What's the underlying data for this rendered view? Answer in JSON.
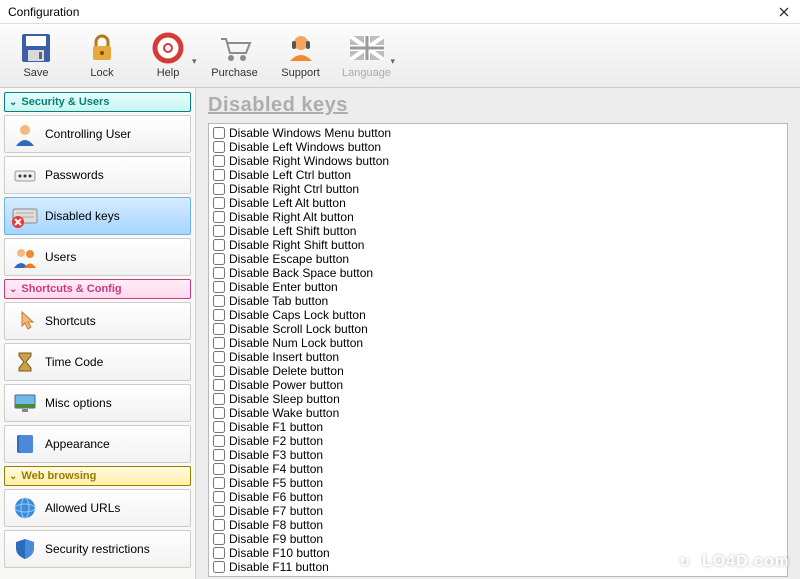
{
  "window": {
    "title": "Configuration"
  },
  "toolbar": {
    "save": "Save",
    "lock": "Lock",
    "help": "Help",
    "purchase": "Purchase",
    "support": "Support",
    "language": "Language"
  },
  "sidebar": {
    "sections": [
      {
        "header": "Security & Users",
        "style": "teal",
        "items": [
          {
            "label": "Controlling User",
            "icon": "user-icon"
          },
          {
            "label": "Passwords",
            "icon": "password-icon"
          },
          {
            "label": "Disabled keys",
            "icon": "keyboard-x-icon",
            "active": true
          },
          {
            "label": "Users",
            "icon": "users-icon"
          }
        ]
      },
      {
        "header": "Shortcuts & Config",
        "style": "pink",
        "items": [
          {
            "label": "Shortcuts",
            "icon": "pointer-icon"
          },
          {
            "label": "Time Code",
            "icon": "hourglass-icon"
          },
          {
            "label": "Misc options",
            "icon": "desktop-icon"
          },
          {
            "label": "Appearance",
            "icon": "book-icon"
          }
        ]
      },
      {
        "header": "Web browsing",
        "style": "yellow",
        "items": [
          {
            "label": "Allowed URLs",
            "icon": "globe-icon"
          },
          {
            "label": "Security restrictions",
            "icon": "shield-icon"
          }
        ]
      }
    ]
  },
  "main": {
    "heading": "Disabled keys",
    "items": [
      "Disable Windows Menu button",
      "Disable Left Windows button",
      "Disable Right Windows button",
      "Disable Left Ctrl button",
      "Disable Right Ctrl button",
      "Disable Left Alt button",
      "Disable Right Alt button",
      "Disable Left Shift button",
      "Disable Right Shift button",
      "Disable Escape button",
      "Disable Back Space button",
      "Disable Enter button",
      "Disable Tab button",
      "Disable Caps Lock button",
      "Disable Scroll Lock button",
      "Disable Num Lock button",
      "Disable Insert button",
      "Disable Delete button",
      "Disable Power button",
      "Disable Sleep button",
      "Disable Wake button",
      "Disable F1 button",
      "Disable F2 button",
      "Disable F3 button",
      "Disable F4 button",
      "Disable F5 button",
      "Disable F6 button",
      "Disable F7 button",
      "Disable F8 button",
      "Disable F9 button",
      "Disable F10 button",
      "Disable F11 button"
    ]
  },
  "watermark": "LO4D.com"
}
